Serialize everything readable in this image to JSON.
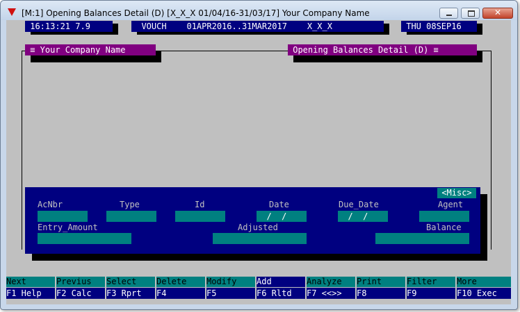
{
  "window": {
    "title": "[M:1]  Opening Balances Detail (D)  [X_X_X  01/04/16-31/03/17]  Your Company Name",
    "minimize_label": "",
    "maximize_label": "",
    "close_label": "✕"
  },
  "status": {
    "time_version": " 16:13:21 7.9 ",
    "voucher_info": "  VOUCH    01APR2016..31MAR2017    X_X_X ",
    "date": " THU 08SEP16 "
  },
  "frame": {
    "left_title": " ≡ Your Company Name ",
    "right_title": " Opening Balances Detail (D) ≡ "
  },
  "detail": {
    "misc_label": "<Misc>",
    "labels": {
      "acnbr": "AcNbr",
      "type": "Type",
      "id": "Id",
      "date": "Date",
      "due_date": "Due_Date",
      "agent": "Agent",
      "entry_amount": "Entry_Amount",
      "adjusted": "Adjusted",
      "balance": "Balance"
    },
    "values": {
      "acnbr": "",
      "type": "",
      "id": "",
      "date": "  /  /",
      "due_date": "  /  /",
      "agent": "",
      "entry_amount": "",
      "adjusted": "",
      "balance": ""
    }
  },
  "fkeys": [
    {
      "action": "Next",
      "key": "F1 Help"
    },
    {
      "action": "Previus",
      "key": "F2 Calc"
    },
    {
      "action": "Select",
      "key": "F3 Rprt"
    },
    {
      "action": "Delete",
      "key": "F4"
    },
    {
      "action": "Modify",
      "key": "F5"
    },
    {
      "action": "Add",
      "key": "F6 Rltd"
    },
    {
      "action": "Analyze",
      "key": "F7 <<>>"
    },
    {
      "action": "Print",
      "key": "F8"
    },
    {
      "action": "Filter",
      "key": "F9"
    },
    {
      "action": "More",
      "key": "F10 Exec"
    }
  ],
  "colors": {
    "navy": "#000080",
    "teal": "#008080",
    "purple": "#800080",
    "background_gray": "#c0c0c0"
  }
}
